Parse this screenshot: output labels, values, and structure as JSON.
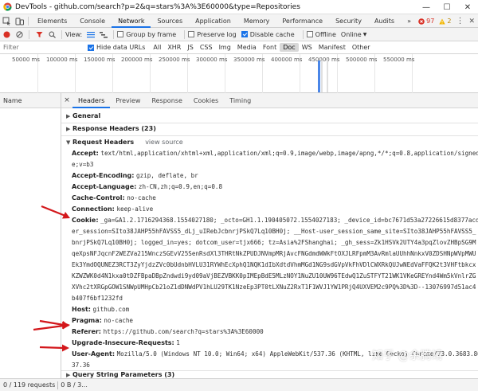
{
  "window": {
    "title": "DevTools - github.com/search?p=2&q=stars%3A%3E60000&type=Repositories",
    "minimize": "—",
    "maximize": "☐",
    "close": "✕"
  },
  "main_tabs": {
    "items": [
      "Elements",
      "Console",
      "Network",
      "Sources",
      "Application",
      "Memory",
      "Performance",
      "Security",
      "Audits"
    ],
    "active": "Network",
    "more": "»",
    "error_count": "97",
    "warning_count": "2"
  },
  "toolbar": {
    "view_label": "View:",
    "group_by_frame": "Group by frame",
    "preserve_log": "Preserve log",
    "disable_cache": "Disable cache",
    "offline": "Offline",
    "online": "Online"
  },
  "filter": {
    "placeholder": "Filter",
    "hide_data_urls": "Hide data URLs",
    "types": [
      "All",
      "XHR",
      "JS",
      "CSS",
      "Img",
      "Media",
      "Font",
      "Doc",
      "WS",
      "Manifest",
      "Other"
    ],
    "selected_type": "Doc"
  },
  "timeline": {
    "labels": [
      "50000 ms",
      "100000 ms",
      "150000 ms",
      "200000 ms",
      "250000 ms",
      "300000 ms",
      "350000 ms",
      "400000 ms",
      "450000 ms",
      "500000 ms",
      "550000 ms"
    ]
  },
  "requests": {
    "column_name": "Name"
  },
  "detail_tabs": {
    "close": "×",
    "items": [
      "Headers",
      "Preview",
      "Response",
      "Cookies",
      "Timing"
    ],
    "active": "Headers"
  },
  "sections": {
    "general": "General",
    "response_headers": "Response Headers (23)",
    "request_headers": "Request Headers",
    "view_source": "view source",
    "query_string": "Query String Parameters (3)"
  },
  "request_headers": [
    {
      "key": "Accept:",
      "value": "text/html,application/xhtml+xml,application/xml;q=0.9,image/webp,image/apng,*/*;q=0.8,application/signed-exchang",
      "cont": [
        "e;v=b3"
      ]
    },
    {
      "key": "Accept-Encoding:",
      "value": "gzip, deflate, br",
      "cont": []
    },
    {
      "key": "Accept-Language:",
      "value": "zh-CN,zh;q=0.9,en;q=0.8",
      "cont": []
    },
    {
      "key": "Cache-Control:",
      "value": "no-cache",
      "cont": []
    },
    {
      "key": "Connection:",
      "value": "keep-alive",
      "cont": []
    },
    {
      "key": "Cookie:",
      "value": "_ga=GA1.2.1716294368.1554027180; _octo=GH1.1.190405072.1554027183; _device_id=bc7671d53a27226615d8377acd570059; us",
      "cont": [
        "er_session=SIto38JAHP55hFAVSS5_dLj_uIRebJcbnrjPSkQ7Lq10BH0j; __Host-user_session_same_site=SIto38JAHP55hFAVSS5_dLj_uIRebJc",
        "bnrjPSkQ7Lq10BH0j; logged_in=yes; dotcom_user=tjx666; tz=Asia%2FShanghai; _gh_sess=Zk1HSVk2UTY4a3pqZlovZHBpSG9MV3hSMU13M3B",
        "qeXpsNFJqcnF2WEZVa215WnczSGEvV25SenRsdXl3THRtNkZPUDJNVmpMRjAvcFNGdmdWWkFtOXJLRFpmM3AvRmlaUUhhNnkxV0ZDSHNpWVpMWUxFYzRvTU5CT",
        "Ek3YmdOQUNEZ3RCT3ZyYjdzZVc0bUdnbHVLU31RYWhEcXphQ1NQK1dIbXdtdVhmMGd1NG9sdGVpVkFhVDlCWXRkQUJwNEdVaFFQK2t3VHFtbkcxSG5NNUVyY1B",
        "KZWZWK0d4N1kxa0tDZFBpaDBpZndwdi9yd09aVjBEZVBKK0pIMEpBdE5MLzNOY1NuZU10UW96TEdwQ1ZuSTFYT21WK1VKeGREYnd4Wm5kVnlrZGxSeW10UXEyd",
        "XVhc2tXRGpGOW1SNWpUMHpCb21oZ1dDNWdPV1hLU29TK1NzeEp3PT0tLXNuZ2RxT1F1WVJ1YW1PRjQ4UXVEM2c9PQ%3D%3D--13076997d51ac466c2c5b1534",
        "b407f6bf1232fd"
      ]
    },
    {
      "key": "Host:",
      "value": "github.com",
      "cont": []
    },
    {
      "key": "Pragma:",
      "value": "no-cache",
      "cont": []
    },
    {
      "key": "Referer:",
      "value": "https://github.com/search?q=stars%3A%3E60000",
      "cont": []
    },
    {
      "key": "Upgrade-Insecure-Requests:",
      "value": "1",
      "cont": []
    },
    {
      "key": "User-Agent:",
      "value": "Mozilla/5.0 (Windows NT 10.0; Win64; x64) AppleWebKit/537.36 (KHTML, like Gecko) Chrome/73.0.3683.86 Safari/5",
      "cont": [
        "37.36"
      ]
    }
  ],
  "status": {
    "requests": "0 / 119 requests",
    "transferred": "0 B / 3..."
  },
  "watermark": {
    "text": "知乎 @余腾靖"
  },
  "colors": {
    "accent": "#1a73e8",
    "arrow": "#d3171b",
    "record": "#d93025"
  }
}
